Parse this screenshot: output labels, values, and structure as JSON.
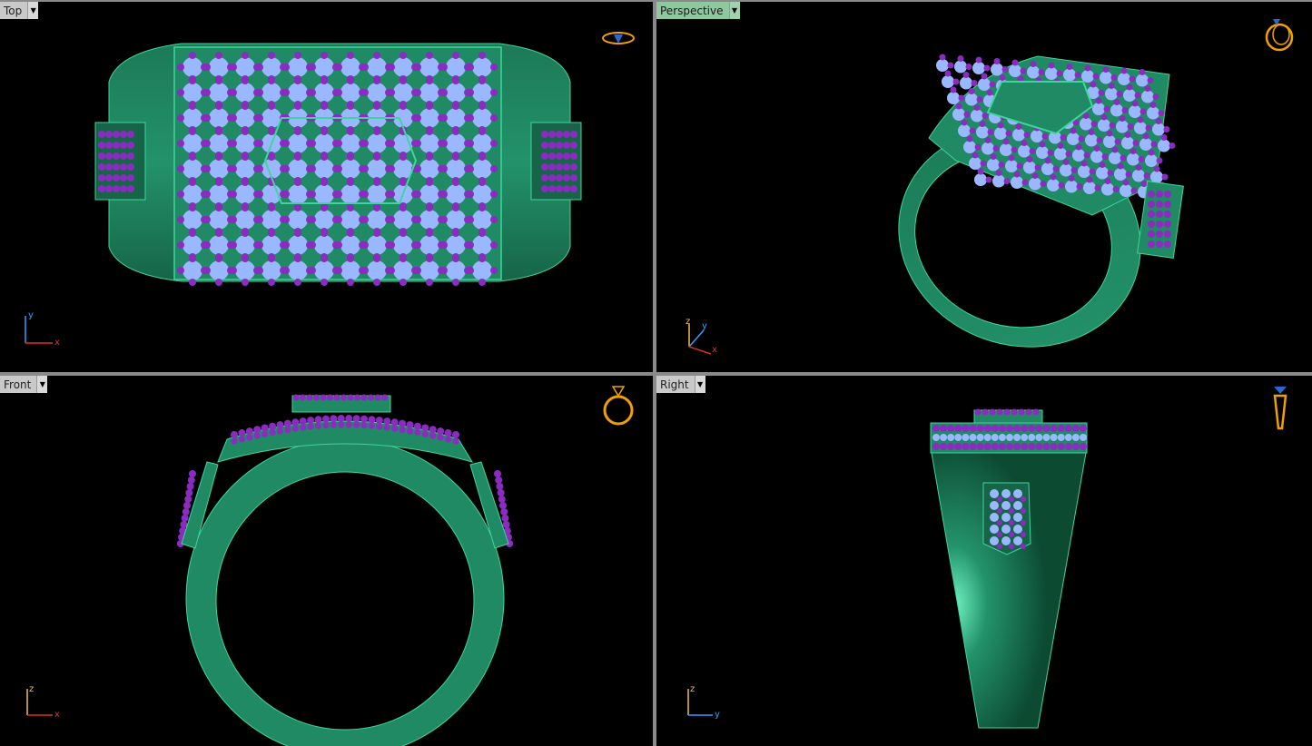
{
  "viewports": {
    "top": {
      "label": "Top"
    },
    "perspective": {
      "label": "Perspective"
    },
    "front": {
      "label": "Front"
    },
    "right": {
      "label": "Right"
    }
  },
  "axes": {
    "top": [
      "y",
      "x"
    ],
    "perspective": [
      "z",
      "y",
      "x"
    ],
    "front": [
      "z",
      "x"
    ],
    "right": [
      "z",
      "y"
    ]
  },
  "colors": {
    "metal": "#1f8a63",
    "metal_edge": "#3fd69a",
    "stone": "#9ab8ff",
    "bead": "#8a2cc0",
    "viewport_bg": "#000000",
    "active_tab": "#8fc79f",
    "axis_x": "#e03020",
    "axis_y": "#30a0ff",
    "axis_z": "#f0c040",
    "icon": "#f0a000"
  },
  "icons": {
    "top": "ring-top-icon",
    "perspective": "ring-perspective-icon",
    "front": "ring-front-icon",
    "right": "ring-side-icon"
  }
}
